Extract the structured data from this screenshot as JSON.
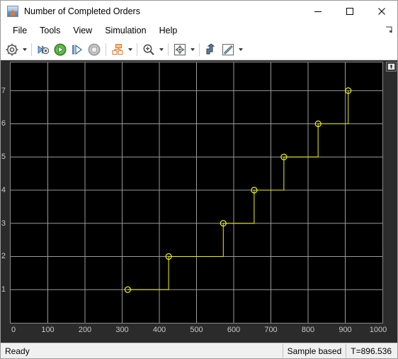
{
  "window": {
    "title": "Number of Completed Orders",
    "app_icon": "simulink-scope-icon",
    "controls": {
      "minimize": "minimize-button",
      "maximize": "maximize-button",
      "close": "close-button"
    }
  },
  "menubar": {
    "items": [
      {
        "label": "File"
      },
      {
        "label": "Tools"
      },
      {
        "label": "View"
      },
      {
        "label": "Simulation"
      },
      {
        "label": "Help"
      }
    ],
    "overflow": "menu-overflow-icon"
  },
  "toolbar": {
    "buttons": [
      {
        "name": "configuration-properties-button",
        "icon": "gear-icon",
        "has_dropdown": true
      },
      {
        "name": "run-back-to-start-button",
        "icon": "rewind-icon",
        "has_dropdown": false
      },
      {
        "name": "run-button",
        "icon": "play-icon",
        "has_dropdown": false
      },
      {
        "name": "step-forward-button",
        "icon": "step-forward-icon",
        "has_dropdown": false
      },
      {
        "name": "stop-button",
        "icon": "stop-icon",
        "has_dropdown": false
      },
      {
        "name": "signal-selector-button",
        "icon": "signal-hierarchy-icon",
        "has_dropdown": true
      },
      {
        "name": "zoom-button",
        "icon": "zoom-in-icon",
        "has_dropdown": true
      },
      {
        "name": "autoscale-button",
        "icon": "scale-axes-icon",
        "has_dropdown": true
      },
      {
        "name": "cursor-measurements-button",
        "icon": "cursor-arrow-icon",
        "has_dropdown": false
      },
      {
        "name": "measurements-button",
        "icon": "ruler-icon",
        "has_dropdown": true
      }
    ]
  },
  "plot": {
    "dock_button": "undock-icon",
    "background": "#000000",
    "grid_color": "#9a9a9a",
    "line_color": "#f2f200",
    "marker_color": "#f2f200"
  },
  "statusbar": {
    "status": "Ready",
    "frame_mode": "Sample based",
    "time": "T=896.536"
  },
  "chart_data": {
    "type": "line",
    "title": "Number of Completed Orders",
    "xlabel": "",
    "ylabel": "",
    "xlim": [
      0,
      1000
    ],
    "ylim": [
      0,
      7.85
    ],
    "grid": true,
    "legend": false,
    "xticks": [
      0,
      100,
      200,
      300,
      400,
      500,
      600,
      700,
      800,
      900,
      1000
    ],
    "yticks": [
      1,
      2,
      3,
      4,
      5,
      6,
      7
    ],
    "interpolation": "stairs",
    "marker": "circle",
    "series": [
      {
        "name": "Number of Completed Orders",
        "color": "#f2f200",
        "x": [
          315,
          425,
          572,
          655,
          735,
          827,
          908
        ],
        "values": [
          1,
          2,
          3,
          4,
          5,
          6,
          7
        ]
      }
    ]
  }
}
